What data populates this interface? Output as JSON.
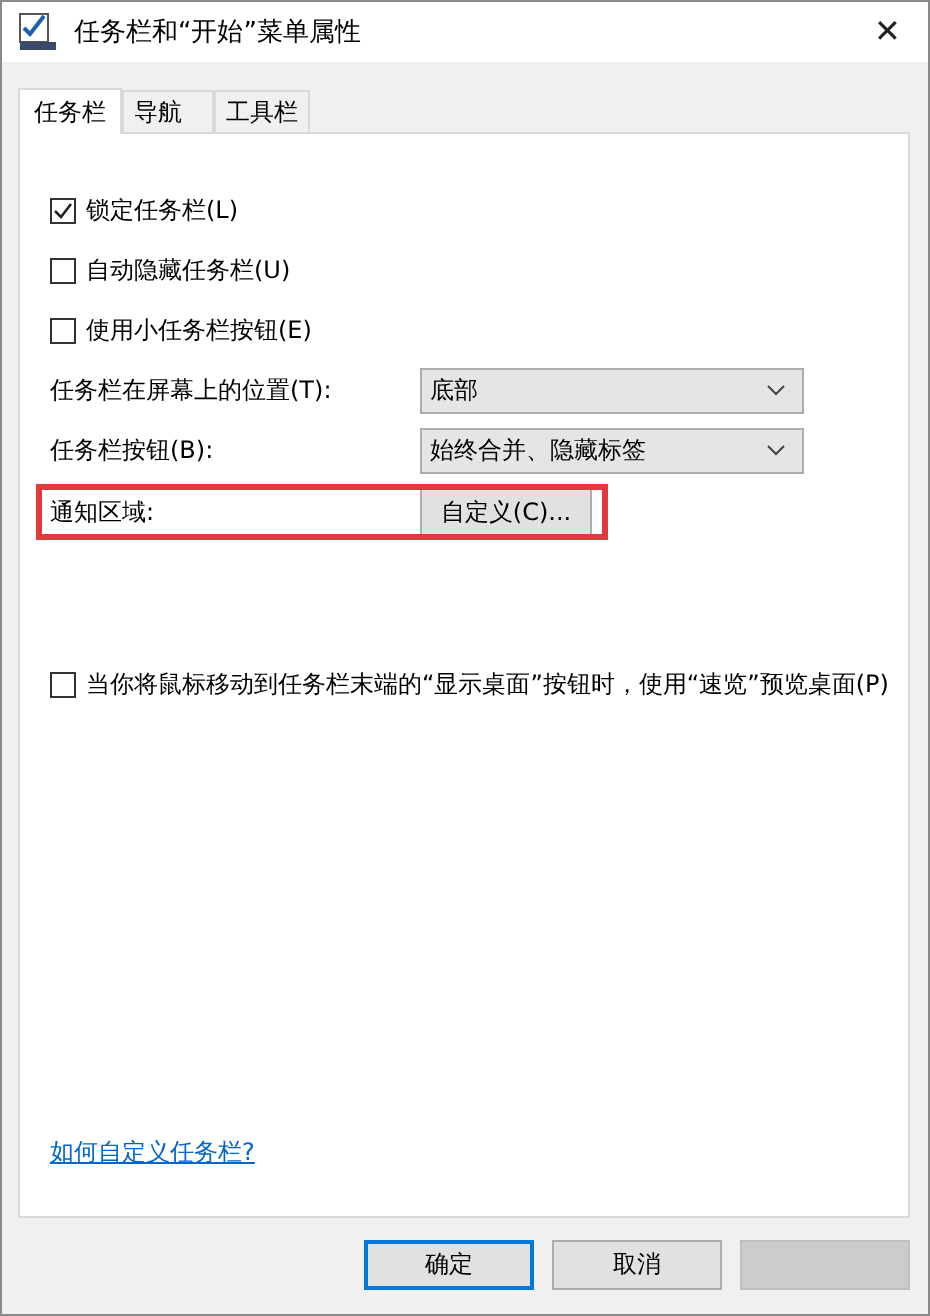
{
  "window": {
    "title": "任务栏和“开始”菜单属性",
    "close": "✕"
  },
  "tabs": [
    {
      "label": "任务栏",
      "selected": true
    },
    {
      "label": "导航",
      "selected": false
    },
    {
      "label": "工具栏",
      "selected": false
    }
  ],
  "options": [
    {
      "label": "锁定任务栏(L)",
      "checked": true
    },
    {
      "label": "自动隐藏任务栏(U)",
      "checked": false
    },
    {
      "label": "使用小任务栏按钮(E)",
      "checked": false
    }
  ],
  "settings": [
    {
      "kind": "dropdown",
      "label": "任务栏在屏幕上的位置(T):",
      "value": "底部",
      "highlighted": false
    },
    {
      "kind": "dropdown",
      "label": "任务栏按钮(B):",
      "value": "始终合并、隐藏标签",
      "highlighted": false
    },
    {
      "kind": "button",
      "label": "通知区域:",
      "value": "自定义(C)...",
      "highlighted": true
    }
  ],
  "peek": {
    "label": "当你将鼠标移动到任务栏末端的“显示桌面”按钮时，使用“速览”预览桌面(P)",
    "checked": false
  },
  "help_link": "如何自定义任务栏?",
  "buttons": [
    {
      "label": "确定",
      "default": true,
      "disabled": false
    },
    {
      "label": "取消",
      "default": false,
      "disabled": false
    },
    {
      "default": false,
      "disabled": true
    }
  ]
}
